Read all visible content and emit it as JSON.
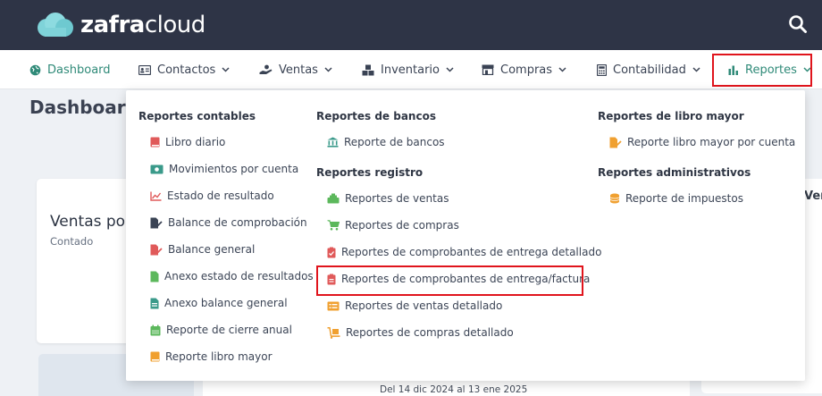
{
  "brand": {
    "name_bold": "zafra",
    "name_light": "cloud"
  },
  "nav": {
    "dashboard": "Dashboard",
    "contactos": "Contactos",
    "ventas": "Ventas",
    "inventario": "Inventario",
    "compras": "Compras",
    "contabilidad": "Contabilidad",
    "reportes": "Reportes"
  },
  "page": {
    "title": "Dashboard",
    "card_title": "Ventas po",
    "card_sub": "Contado",
    "date_range": "Del 14 dic 2024 al 13 ene 2025",
    "right_card_title": "Ver"
  },
  "menu": {
    "contables": {
      "heading": "Reportes contables",
      "items": [
        "Libro diario",
        "Movimientos por cuenta",
        "Estado de resultado",
        "Balance de comprobación",
        "Balance general",
        "Anexo estado de resultados",
        "Anexo balance general",
        "Reporte de cierre anual",
        "Reporte libro mayor"
      ]
    },
    "bancos": {
      "heading": "Reportes de bancos",
      "items": [
        "Reporte de bancos"
      ]
    },
    "registro": {
      "heading": "Reportes registro",
      "items": [
        "Reportes de ventas",
        "Reportes de compras",
        "Reportes de comprobantes de entrega detallado",
        "Reportes de comprobantes de entrega/factura",
        "Reportes de ventas detallado",
        "Reportes de compras detallado"
      ]
    },
    "libro_mayor": {
      "heading": "Reportes de libro mayor",
      "items": [
        "Reporte libro mayor por cuenta"
      ]
    },
    "administrativos": {
      "heading": "Reportes administrativos",
      "items": [
        "Reporte de impuestos"
      ]
    }
  },
  "colors": {
    "topbar": "#2e3446",
    "accent": "#2f8a78",
    "highlight": "#e0141c",
    "icon_red": "#e05a5a",
    "icon_teal": "#3a9a8a",
    "icon_green": "#5cb85c",
    "icon_orange": "#f0a030",
    "icon_dark": "#3a4354"
  }
}
